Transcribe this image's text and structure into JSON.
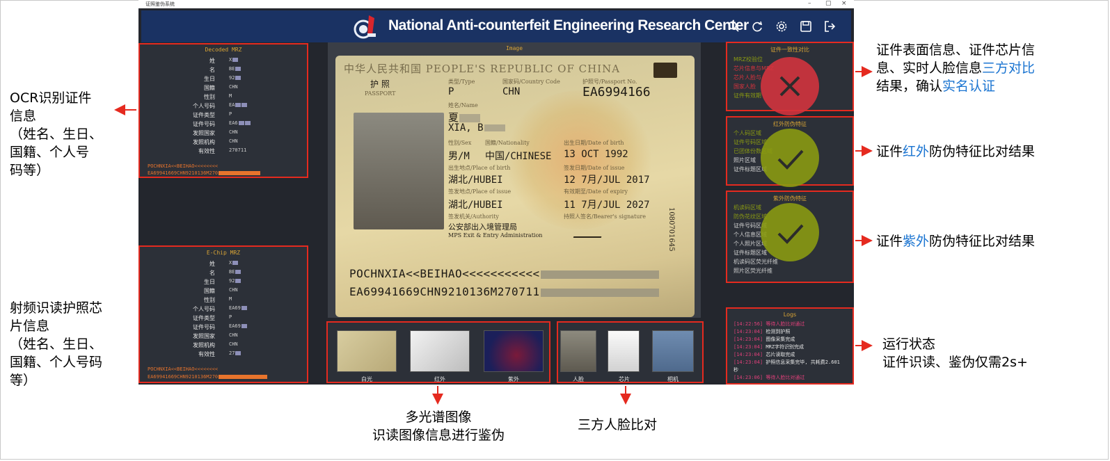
{
  "window": {
    "title": "证照鉴伪系统",
    "controls": [
      "–",
      "▢",
      "×"
    ]
  },
  "header": {
    "title": "National Anti-counterfeit Engineering Research Center",
    "icons": [
      "search-icon",
      "refresh-icon",
      "gear-icon",
      "save-icon",
      "logout-icon"
    ]
  },
  "decoded_mrz": {
    "title": "Decoded MRZ",
    "rows": [
      {
        "label": "姓",
        "value": "X"
      },
      {
        "label": "名",
        "value": "BE"
      },
      {
        "label": "生日",
        "value": "92"
      },
      {
        "label": "国籍",
        "value": "CHN"
      },
      {
        "label": "性别",
        "value": "M"
      },
      {
        "label": "个人号码",
        "value": "EA"
      },
      {
        "label": "证件类型",
        "value": "P"
      },
      {
        "label": "证件号码",
        "value": "EA6"
      },
      {
        "label": "发照国家",
        "value": "CHN"
      },
      {
        "label": "发照机构",
        "value": "CHN"
      },
      {
        "label": "有效性",
        "value": "270711"
      }
    ],
    "mrz1": "POCHNXIA<<BEIHAO<<<<<<<<",
    "mrz2": "EA69941669CHN9210136M270"
  },
  "echip_mrz": {
    "title": "E-Chip MRZ",
    "rows": [
      {
        "label": "姓",
        "value": "X"
      },
      {
        "label": "名",
        "value": "BE"
      },
      {
        "label": "生日",
        "value": "92"
      },
      {
        "label": "国籍",
        "value": "CHN"
      },
      {
        "label": "性别",
        "value": "M"
      },
      {
        "label": "个人号码",
        "value": "EA69"
      },
      {
        "label": "证件类型",
        "value": "P"
      },
      {
        "label": "证件号码",
        "value": "EA69"
      },
      {
        "label": "发照国家",
        "value": "CHN"
      },
      {
        "label": "发照机构",
        "value": "CHN"
      },
      {
        "label": "有效性",
        "value": "27"
      }
    ],
    "mrz1": "POCHNXIA<<BEIHAO<<<<<<<<",
    "mrz2": "EA69941669CHN9210136M270"
  },
  "image_panel": {
    "title": "Image",
    "passport": {
      "header": "中华人民共和国 PEOPLE'S REPUBLIC OF CHINA",
      "doc_cn": "护 照",
      "doc_en": "PASSPORT",
      "type_label": "类型/Type",
      "type": "P",
      "country_label": "国家码/Country Code",
      "country": "CHN",
      "number_label": "护照号/Passport No.",
      "number": "EA6994166",
      "name_label": "姓名/Name",
      "name_cn": "夏",
      "name_en": "XIA, B",
      "sex_label": "性别/Sex",
      "sex": "男/M",
      "nationality_label": "国籍/Nationality",
      "nationality": "中国/CHINESE",
      "dob_label": "出生日期/Date of birth",
      "dob": "13 OCT 1992",
      "pob_label": "出生地点/Place of birth",
      "pob": "湖北/HUBEI",
      "doi_label": "签发日期/Date of issue",
      "doi": "12 7月/JUL 2017",
      "poi_label": "签发地点/Place of issue",
      "poi": "湖北/HUBEI",
      "doe_label": "有效期至/Date of expiry",
      "doe": "11 7月/JUL 2027",
      "authority_label": "签发机关/Authority",
      "authority_cn": "公安部出入境管理局",
      "authority_en": "MPS Exit & Entry Administration",
      "signature_label": "持照人签名/Bearer's signature",
      "serial": "1080701645",
      "mrz1": "POCHNXIA<<BEIHAO<<<<<<<<<<<",
      "mrz2": "EA69941669CHN9210136M270711"
    }
  },
  "thumbnails": [
    {
      "label": "白光"
    },
    {
      "label": "红外"
    },
    {
      "label": "紫外"
    }
  ],
  "faces": [
    {
      "label": "人脸"
    },
    {
      "label": "芯片"
    },
    {
      "label": "相机"
    }
  ],
  "consistency": {
    "title": "证件一致性对比",
    "items": [
      "MRZ校验位",
      "芯片信息与MRZ",
      "芯片人脸与",
      "国家人脸",
      "证件有效期"
    ],
    "result": "fail"
  },
  "infrared": {
    "title": "红外防伪特征",
    "items": [
      "个人码区域",
      "证件号码区域",
      "已团体份数区域",
      "照片区域",
      "证件标题区域"
    ],
    "result": "pass"
  },
  "ultraviolet": {
    "title": "紫外防伪特征",
    "items": [
      "机读码区域",
      "防伪花纹区域",
      "证件号码区域",
      "个人信息区域",
      "个人照片区域",
      "证件标题区域",
      "机读码区荧光纤维",
      "照片区荧光纤维"
    ],
    "result": "pass"
  },
  "logs": {
    "title": "Logs",
    "entries": [
      {
        "time": "[14:22:56]",
        "text": "等待人脸比对通过",
        "color": "#e0407a"
      },
      {
        "time": "[14:23:04]",
        "text": "检测到护照",
        "color": "#e6e6e6"
      },
      {
        "time": "[14:23:04]",
        "text": "图像采集完成",
        "color": "#e6e6e6"
      },
      {
        "time": "[14:23:04]",
        "text": "MRZ字符识别完成",
        "color": "#e6e6e6"
      },
      {
        "time": "[14:23:04]",
        "text": "芯片读取完成",
        "color": "#e6e6e6"
      },
      {
        "time": "[14:23:04]",
        "text": "护照信息采集完毕, 共耗费2.601",
        "color": "#e6e6e6"
      },
      {
        "time": "",
        "text": "秒",
        "color": "#e6e6e6"
      },
      {
        "time": "[14:23:06]",
        "text": "等待人脸比对通过",
        "color": "#e0407a"
      }
    ]
  },
  "annotations": {
    "ocr": [
      "OCR识别证件",
      "信息",
      "（姓名、生日、",
      "国籍、个人号",
      "码等）"
    ],
    "rfid": [
      "射频识读护照芯",
      "片信息",
      "（姓名、生日、",
      "国籍、个人号码",
      "等）"
    ],
    "tri_compare_1a": "证件表面信息、证件芯片信",
    "tri_compare_2a": "息、实时人脸信息",
    "tri_compare_2b": "三方对比",
    "tri_compare_3a": "结果，确认",
    "tri_compare_3b": "实名认证",
    "ir_a": "证件",
    "ir_b": "红外",
    "ir_c": "防伪特征比对结果",
    "uv_a": "证件",
    "uv_b": "紫外",
    "uv_c": "防伪特征比对结果",
    "status_1": "运行状态",
    "status_2": "证件识读、鉴伪仅需2s+",
    "multispectral_1": "多光谱图像",
    "multispectral_2": "识读图像信息进行鉴伪",
    "face_compare": "三方人脸比对"
  },
  "colors": {
    "accent_red": "#e52a1f",
    "header_blue": "#1a3263",
    "label_gold": "#d9a435",
    "pass_olive": "#8a9a12",
    "fail_red": "#d6333d",
    "highlight_blue": "#1a74d1"
  }
}
